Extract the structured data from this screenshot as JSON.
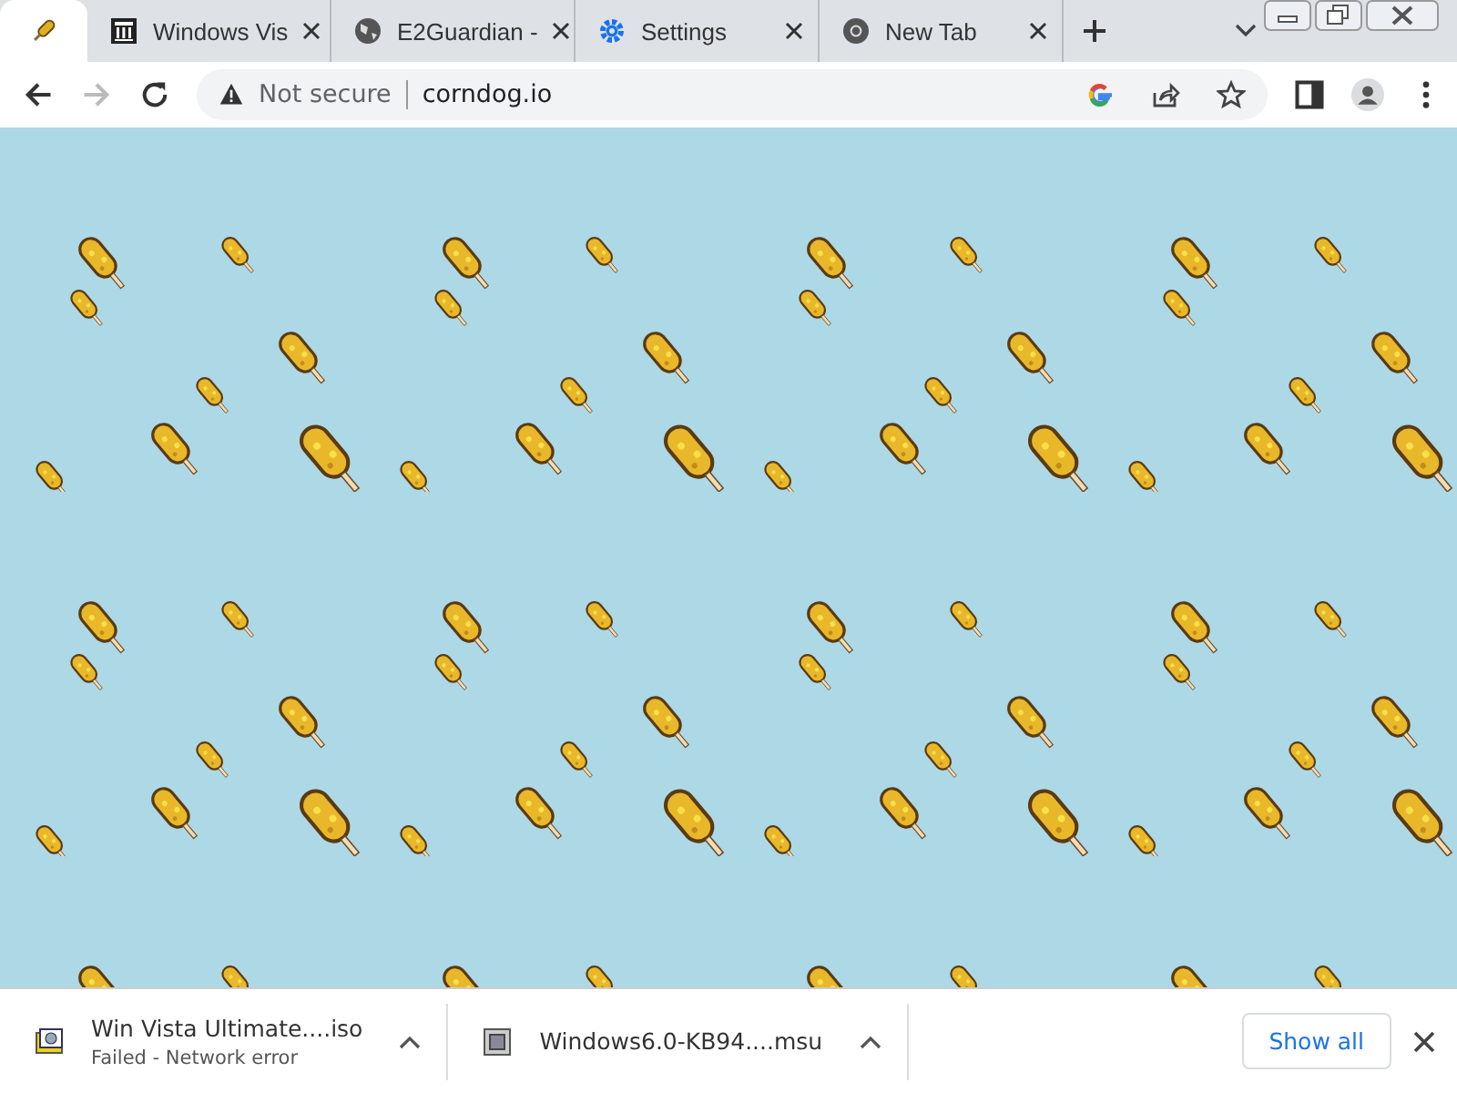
{
  "tabs": [
    {
      "selected": true
    },
    {
      "title": "Windows Vis",
      "selected": false
    },
    {
      "title": "E2Guardian -",
      "selected": false
    },
    {
      "title": "Settings",
      "selected": false
    },
    {
      "title": "New Tab",
      "selected": false
    }
  ],
  "address_bar": {
    "security": "Not secure",
    "url": "corndog.io"
  },
  "downloads": [
    {
      "name": "Win Vista Ultimate....iso",
      "status": "Failed - Network error"
    },
    {
      "name": "Windows6.0-KB94....msu"
    }
  ],
  "show_all": "Show all"
}
